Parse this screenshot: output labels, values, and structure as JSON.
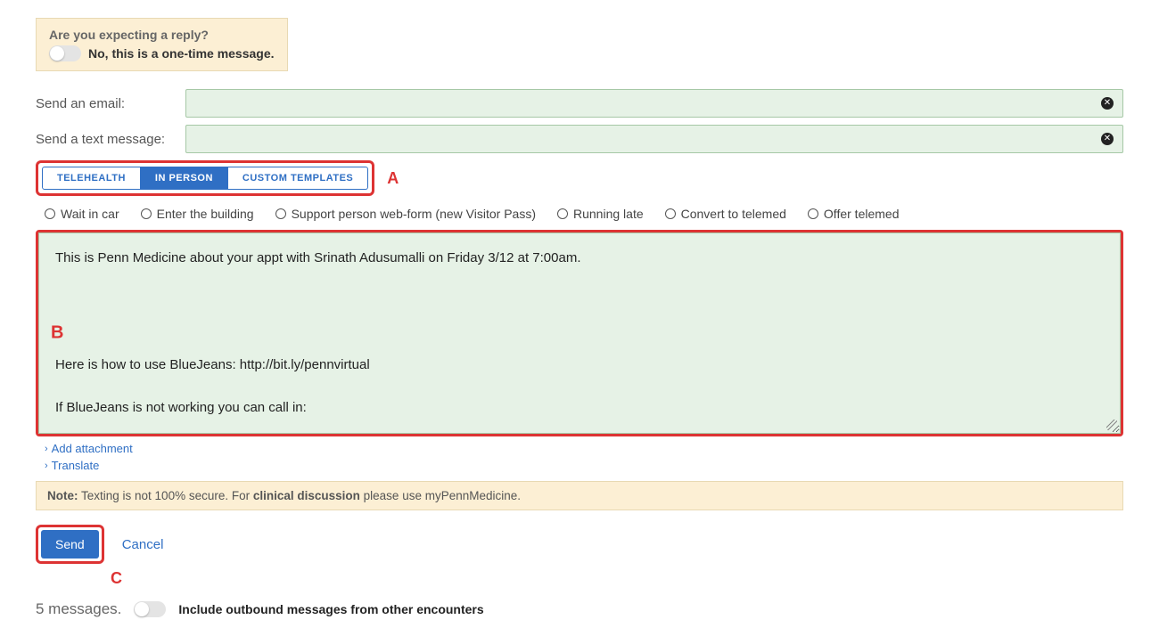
{
  "replyPrompt": {
    "heading": "Are you expecting a reply?",
    "toggleLabel": "No, this is a one-time message."
  },
  "emailLabel": "Send an email:",
  "textLabel": "Send a text message:",
  "tabs": {
    "telehealth": "TELEHEALTH",
    "inperson": "IN PERSON",
    "custom": "CUSTOM TEMPLATES"
  },
  "annotations": {
    "a": "A",
    "b": "B",
    "c": "C"
  },
  "radios": {
    "wait": "Wait in car",
    "enter": "Enter the building",
    "support": "Support person web-form (new Visitor Pass)",
    "late": "Running late",
    "convert": "Convert to telemed",
    "offer": "Offer telemed"
  },
  "message": "This is Penn Medicine about your appt with Srinath Adusumalli on Friday 3/12 at 7:00am.\n\n\n\n\nHere is how to use BlueJeans: http://bit.ly/pennvirtual\n\nIf BlueJeans is not working you can call in:",
  "links": {
    "attach": "Add attachment",
    "translate": "Translate"
  },
  "note": {
    "prefix": "Note:",
    "mid1": " Texting is not 100% secure. For ",
    "bold": "clinical discussion",
    "mid2": " please use myPennMedicine."
  },
  "actions": {
    "send": "Send",
    "cancel": "Cancel"
  },
  "footer": {
    "count": "5 messages.",
    "toggleLabel": "Include outbound messages from other encounters"
  }
}
